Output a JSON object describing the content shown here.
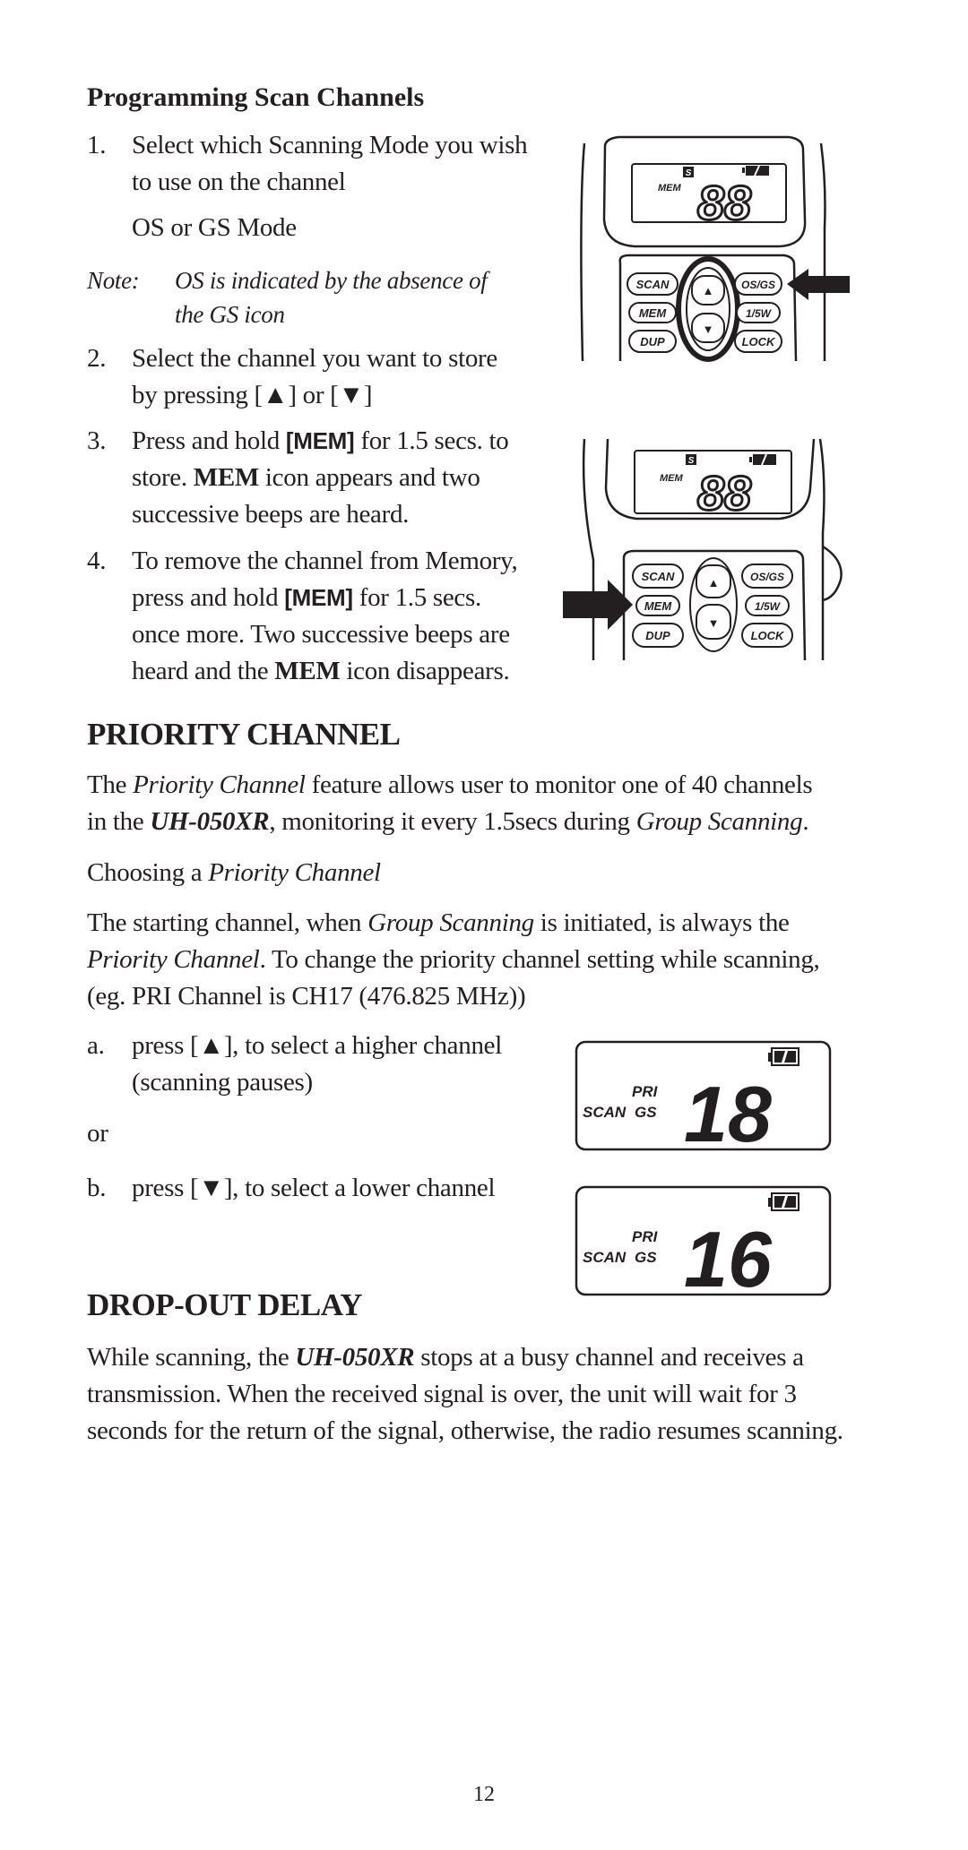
{
  "section_programming": {
    "heading": "Programming Scan Channels",
    "step1": {
      "num": "1.",
      "line1": "Select which Scanning Mode you wish",
      "line2": "to use on the channel",
      "sub": "OS or GS Mode"
    },
    "note": {
      "label": "Note:",
      "line1": "OS is indicated by the absence of",
      "line2": "the GS icon"
    },
    "step2": {
      "num": "2.",
      "line1": "Select the channel you want to store",
      "line2_pre": "by pressing [",
      "up": "▲",
      "mid": "] or [",
      "down": "▼",
      "end": "]"
    },
    "step3": {
      "num": "3.",
      "line1_pre": "Press and hold ",
      "key": "[MEM]",
      "line1_post": " for 1.5 secs. to",
      "line2_pre": "store. ",
      "mem": "MEM",
      "line2_post": " icon appears and two",
      "line3": "successive beeps are heard."
    },
    "step4": {
      "num": "4.",
      "line1": "To remove the channel from Memory,",
      "line2_pre": "press and hold ",
      "key": "[MEM]",
      "line2_post": " for 1.5 secs.",
      "line3": "once more. Two successive beeps are",
      "line4_pre": "heard and the ",
      "mem": "MEM",
      "line4_post": " icon disappears."
    }
  },
  "radio_figures": [
    {
      "highlight": "up/down keys circled, arrow pointing to OS/GS",
      "display": {
        "mem_label": "MEM",
        "s_icon": "S",
        "digits": "88"
      },
      "buttons": {
        "scan": "SCAN",
        "mem": "MEM",
        "dup": "DUP",
        "osgs": "OS/GS",
        "power": "1/5W",
        "lock": "LOCK",
        "up": "▲",
        "down": "▼"
      }
    },
    {
      "highlight": "arrow pointing to MEM",
      "display": {
        "mem_label": "MEM",
        "s_icon": "S",
        "digits": "88"
      },
      "buttons": {
        "scan": "SCAN",
        "mem": "MEM",
        "dup": "DUP",
        "osgs": "OS/GS",
        "power": "1/5W",
        "lock": "LOCK",
        "up": "▲",
        "down": "▼"
      }
    }
  ],
  "section_priority": {
    "heading": "PRIORITY CHANNEL",
    "p1": {
      "t1": "The ",
      "i1": "Priority Channel",
      "t2": " feature allows user to monitor one of 40 channels",
      "t3": "in the ",
      "model": "UH-050XR",
      "t4": ", monitoring it every 1.5secs during ",
      "i2": "Group Scanning",
      "t5": "."
    },
    "p2": {
      "t1": "Choosing a ",
      "i1": "Priority Channel"
    },
    "p3": {
      "t1": "The starting channel, when ",
      "i1": "Group Scanning",
      "t2": " is initiated, is always the",
      "i2": "Priority Channel",
      "t3": ". To change the priority channel setting while scanning,",
      "t4": "(eg. PRI Channel is CH17 (476.825 MHz))"
    },
    "a": {
      "label": "a.",
      "pre": "press [",
      "arrow": "▲",
      "post": "], to select a higher channel",
      "line2": "(scanning pauses)"
    },
    "or": "or",
    "b": {
      "label": "b.",
      "pre": "press [",
      "arrow": "▼",
      "post": "], to select a lower channel"
    }
  },
  "lcd_figures": [
    {
      "scan": "SCAN",
      "pri": "PRI",
      "gs": "GS",
      "channel": "18"
    },
    {
      "scan": "SCAN",
      "pri": "PRI",
      "gs": "GS",
      "channel": "16"
    }
  ],
  "section_dropout": {
    "heading": "DROP-OUT DELAY",
    "t1": "While scanning, the ",
    "model": "UH-050XR",
    "t2": " stops at a busy channel and receives a",
    "line2": "transmission. When the received signal is over, the unit will wait for 3",
    "line3": "seconds for the return of the signal, otherwise, the radio resumes scanning."
  },
  "page_number": "12"
}
